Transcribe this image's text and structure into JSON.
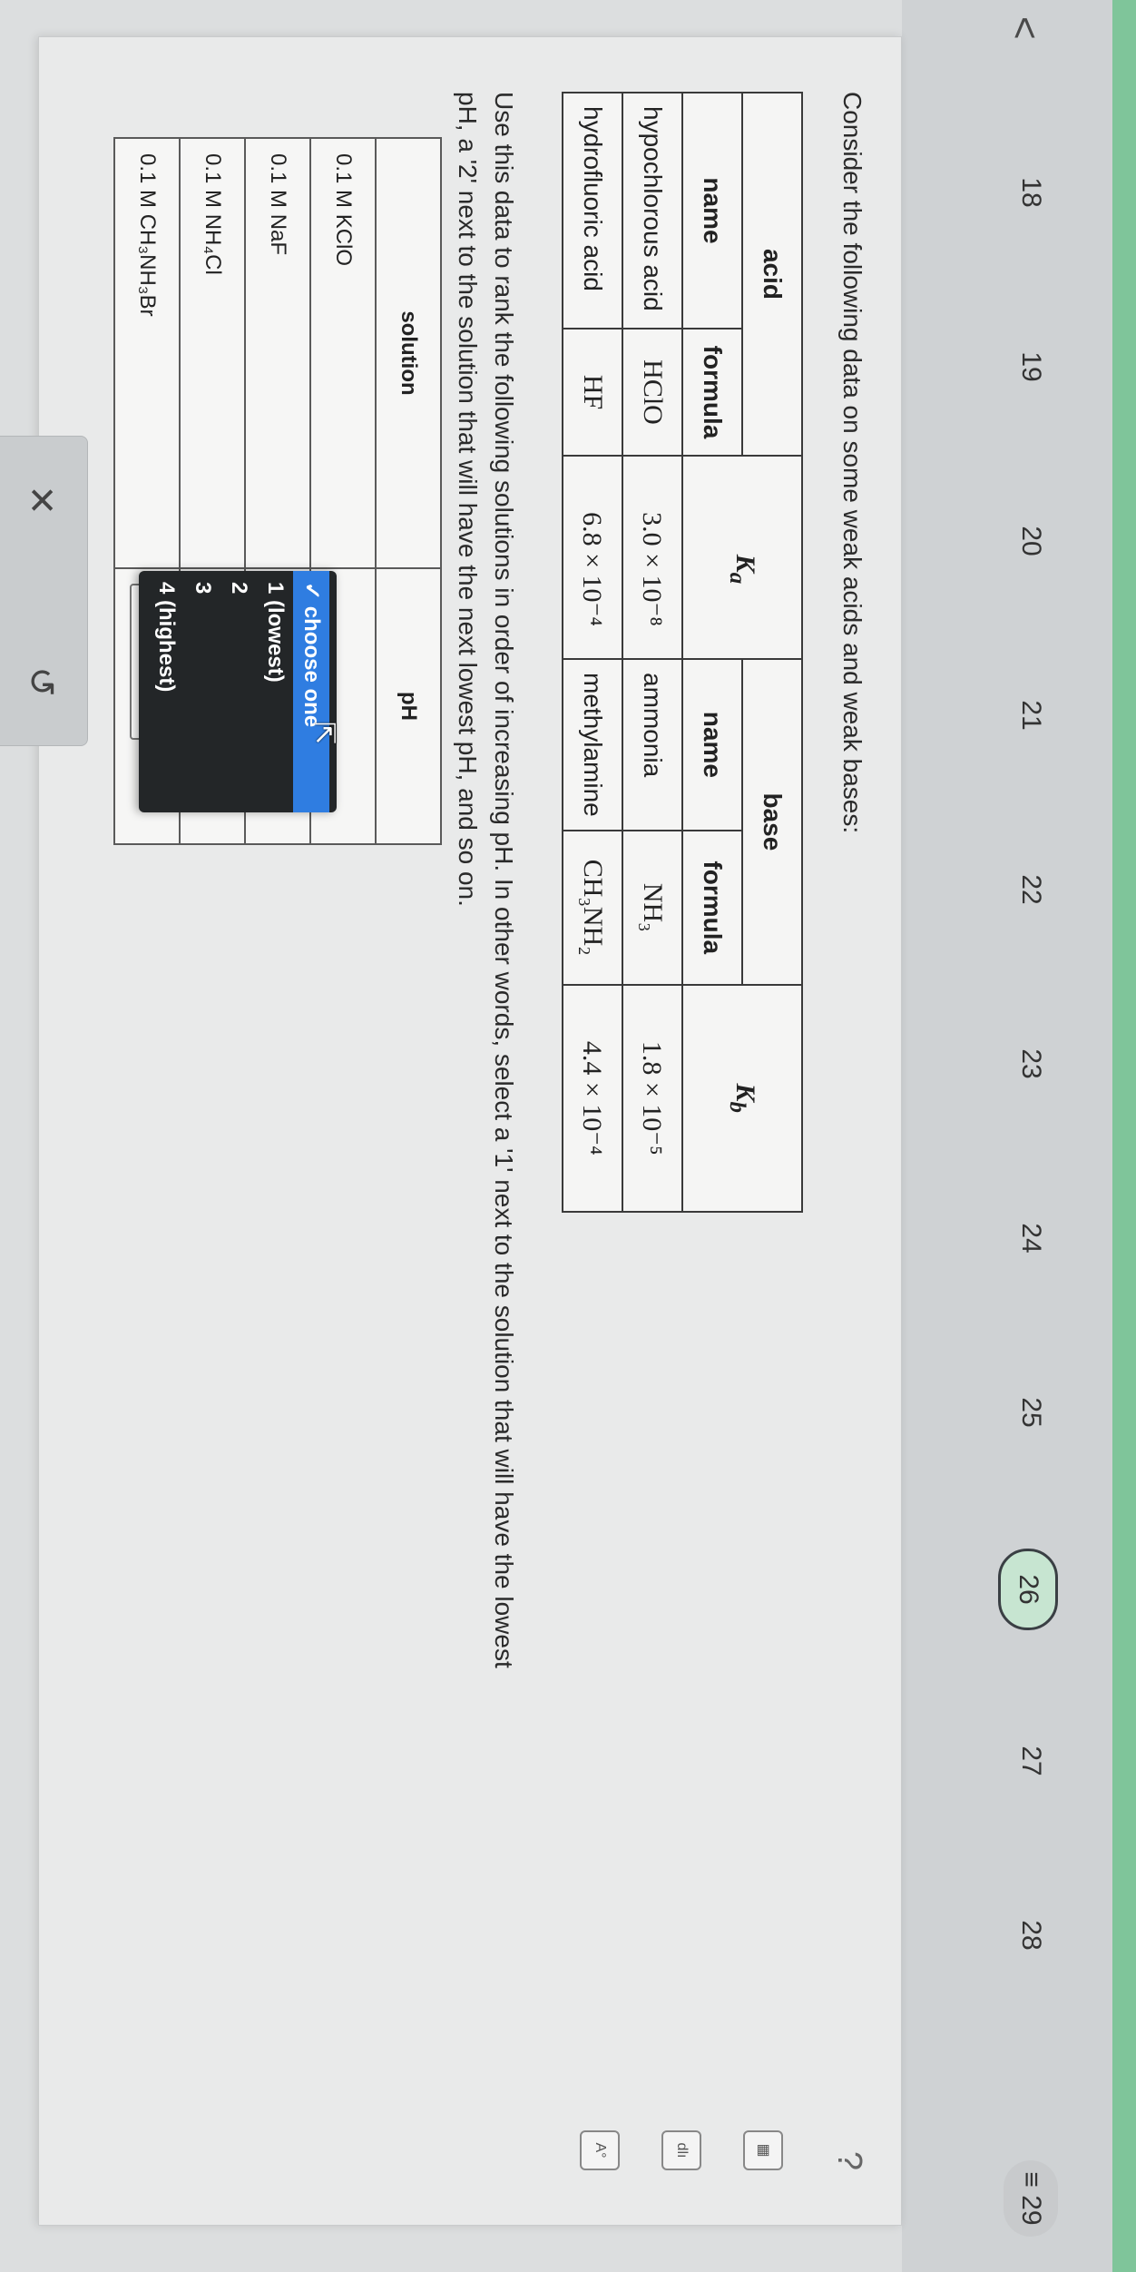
{
  "nav": {
    "back": "<",
    "questions": [
      "18",
      "19",
      "20",
      "21",
      "22",
      "23",
      "24",
      "25",
      "26",
      "27",
      "28"
    ],
    "active": "26",
    "last": "29",
    "last_menu_glyph": "≡"
  },
  "icons": {
    "help": "?",
    "calculator": "▦",
    "chart": "dlı",
    "text_size": "A°"
  },
  "intro": "Consider the following data on some weak acids and weak bases:",
  "acid_table": {
    "group": "acid",
    "name_header": "name",
    "formula_header": "formula",
    "k_header": "Ka",
    "rows": [
      {
        "name": "hypochlorous acid",
        "formula": "HClO",
        "k": "3.0 × 10⁻⁸"
      },
      {
        "name": "hydrofluoric acid",
        "formula": "HF",
        "k": "6.8 × 10⁻⁴"
      }
    ]
  },
  "base_table": {
    "group": "base",
    "name_header": "name",
    "formula_header": "formula",
    "k_header": "Kb",
    "rows": [
      {
        "name": "ammonia",
        "formula": "NH₃",
        "k": "1.8 × 10⁻⁵"
      },
      {
        "name": "methylamine",
        "formula": "CH₃NH₂",
        "k": "4.4 × 10⁻⁴"
      }
    ]
  },
  "instructions": "Use this data to rank the following solutions in order of increasing pH. In other words, select a '1' next to the solution that will have the lowest pH, a '2' next to the solution that will have the next lowest pH, and so on.",
  "rank_table": {
    "solution_header": "solution",
    "ph_header": "pH",
    "rows": [
      {
        "solution": "0.1 M KClO"
      },
      {
        "solution": "0.1 M NaF"
      },
      {
        "solution": "0.1 M NH₄Cl"
      },
      {
        "solution": "0.1 M CH₃NH₃Br",
        "ph": "choose one ∨"
      }
    ]
  },
  "dropdown": {
    "options": [
      "✓ choose one",
      "1 (lowest)",
      "2",
      "3",
      "4 (highest)"
    ]
  },
  "actions": {
    "clear": "✕",
    "undo": "↺"
  }
}
